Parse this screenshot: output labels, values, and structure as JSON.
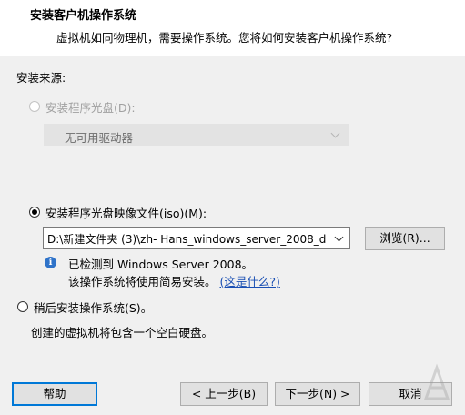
{
  "header": {
    "title": "安装客户机操作系统",
    "subtitle": "虚拟机如同物理机，需要操作系统。您将如何安装客户机操作系统?"
  },
  "install_source": {
    "label": "安装来源:",
    "disc_option": {
      "label": "安装程序光盘(D):",
      "selected": false,
      "enabled": false,
      "dropdown_value": "无可用驱动器"
    },
    "iso_option": {
      "label": "安装程序光盘映像文件(iso)(M):",
      "selected": true,
      "path_value": "D:\\新建文件夹 (3)\\zh- Hans_windows_server_2008_d",
      "browse_label": "浏览(R)..."
    },
    "detected": {
      "line1": "已检测到 Windows Server 2008。",
      "line2": "该操作系统将使用简易安装。",
      "link_text": "(这是什么?)"
    },
    "later_option": {
      "label": "稍后安装操作系统(S)。",
      "selected": false,
      "description": "创建的虚拟机将包含一个空白硬盘。"
    }
  },
  "footer": {
    "help_label": "帮助",
    "back_label": "< 上一步(B)",
    "next_label": "下一步(N) >",
    "cancel_label": "取消"
  },
  "icons": {
    "info": "info-icon",
    "dropdown": "chevron-down-icon"
  },
  "colors": {
    "focus_border": "#0078d7",
    "link": "#1a4fb3",
    "info_icon": "#2f73c9",
    "disabled_text": "#a0a0a0"
  }
}
